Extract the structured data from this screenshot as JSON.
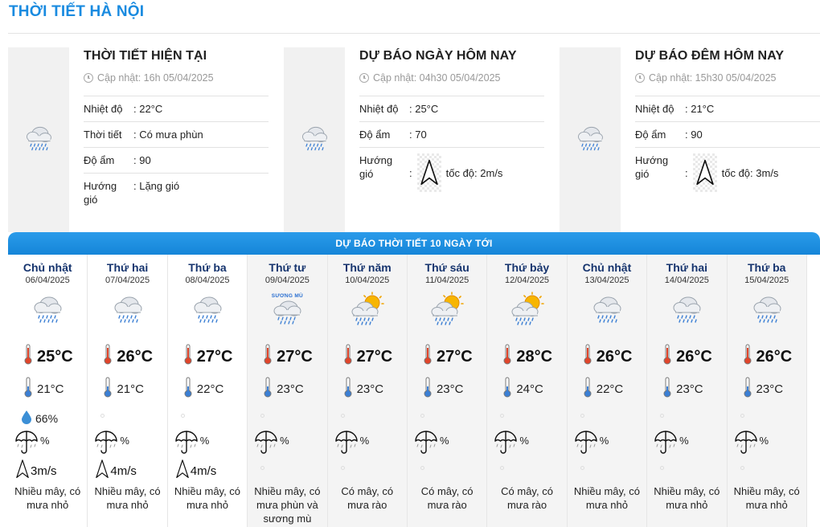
{
  "page": {
    "title": "THỜI TIẾT HÀ NỘI"
  },
  "colors": {
    "accent": "#1a8be0",
    "banner": "#1f91e2",
    "day_name": "#16346e"
  },
  "cards": [
    {
      "title": "THỜI TIẾT HIỆN TẠI",
      "updated": "Cập nhật: 16h 05/04/2025",
      "icon": "rain-cloud-icon",
      "rows": [
        {
          "label": "Nhiệt độ",
          "value": ": 22°C"
        },
        {
          "label": "Thời tiết",
          "value": ": Có mưa phùn"
        },
        {
          "label": "Độ ẩm",
          "value": ": 90"
        },
        {
          "label": "Hướng gió",
          "value": ": Lặng gió"
        }
      ]
    },
    {
      "title": "DỰ BÁO NGÀY HÔM NAY",
      "updated": "Cập nhật: 04h30 05/04/2025",
      "icon": "rain-cloud-icon",
      "rows": [
        {
          "label": "Nhiệt độ",
          "value": ": 25°C"
        },
        {
          "label": "Độ ẩm",
          "value": ": 70"
        },
        {
          "label": "Hướng gió",
          "value": ":",
          "wind": "tốc độ: 2m/s"
        }
      ]
    },
    {
      "title": "DỰ BÁO ĐÊM HÔM NAY",
      "updated": "Cập nhật: 15h30 05/04/2025",
      "icon": "rain-cloud-icon",
      "rows": [
        {
          "label": "Nhiệt độ",
          "value": ": 21°C"
        },
        {
          "label": "Độ ẩm",
          "value": ": 90"
        },
        {
          "label": "Hướng gió",
          "value": ":",
          "wind": "tốc độ: 3m/s"
        }
      ]
    }
  ],
  "banner": {
    "label": "DỰ BÁO THỜI TIẾT 10 NGÀY TỚI"
  },
  "days": [
    {
      "name": "Chủ nhật",
      "date": "06/04/2025",
      "icon": "rain-cloud-icon",
      "tmax": "25°C",
      "tmin": "21°C",
      "humidity": "66%",
      "rain": "%",
      "wind": "3m/s",
      "desc": "Nhiều mây, có mưa nhỏ"
    },
    {
      "name": "Thứ hai",
      "date": "07/04/2025",
      "icon": "rain-cloud-icon",
      "tmax": "26°C",
      "tmin": "21°C",
      "humidity": "",
      "rain": "%",
      "wind": "4m/s",
      "desc": "Nhiều mây, có mưa nhỏ"
    },
    {
      "name": "Thứ ba",
      "date": "08/04/2025",
      "icon": "rain-cloud-icon",
      "tmax": "27°C",
      "tmin": "22°C",
      "humidity": "",
      "rain": "%",
      "wind": "4m/s",
      "desc": "Nhiều mây, có mưa nhỏ"
    },
    {
      "name": "Thứ tư",
      "date": "09/04/2025",
      "icon": "fog-rain-icon",
      "tag": "SƯƠNG MÙ",
      "tmax": "27°C",
      "tmin": "23°C",
      "humidity": "",
      "rain": "%",
      "wind": "",
      "desc": "Nhiều mây, có mưa phùn và sương mù"
    },
    {
      "name": "Thứ năm",
      "date": "10/04/2025",
      "icon": "sun-rain-cloud-icon",
      "tmax": "27°C",
      "tmin": "23°C",
      "humidity": "",
      "rain": "%",
      "wind": "",
      "desc": "Có mây, có mưa rào"
    },
    {
      "name": "Thứ sáu",
      "date": "11/04/2025",
      "icon": "sun-rain-cloud-icon",
      "tmax": "27°C",
      "tmin": "23°C",
      "humidity": "",
      "rain": "%",
      "wind": "",
      "desc": "Có mây, có mưa rào"
    },
    {
      "name": "Thứ bảy",
      "date": "12/04/2025",
      "icon": "sun-rain-cloud-icon",
      "tmax": "28°C",
      "tmin": "24°C",
      "humidity": "",
      "rain": "%",
      "wind": "",
      "desc": "Có mây, có mưa rào"
    },
    {
      "name": "Chủ nhật",
      "date": "13/04/2025",
      "icon": "rain-cloud-icon",
      "tmax": "26°C",
      "tmin": "22°C",
      "humidity": "",
      "rain": "%",
      "wind": "",
      "desc": "Nhiều mây, có mưa nhỏ"
    },
    {
      "name": "Thứ hai",
      "date": "14/04/2025",
      "icon": "rain-cloud-icon",
      "tmax": "26°C",
      "tmin": "23°C",
      "humidity": "",
      "rain": "%",
      "wind": "",
      "desc": "Nhiều mây, có mưa nhỏ"
    },
    {
      "name": "Thứ ba",
      "date": "15/04/2025",
      "icon": "rain-cloud-icon",
      "tmax": "26°C",
      "tmin": "23°C",
      "humidity": "",
      "rain": "%",
      "wind": "",
      "desc": "Nhiều mây, có mưa nhỏ"
    }
  ]
}
